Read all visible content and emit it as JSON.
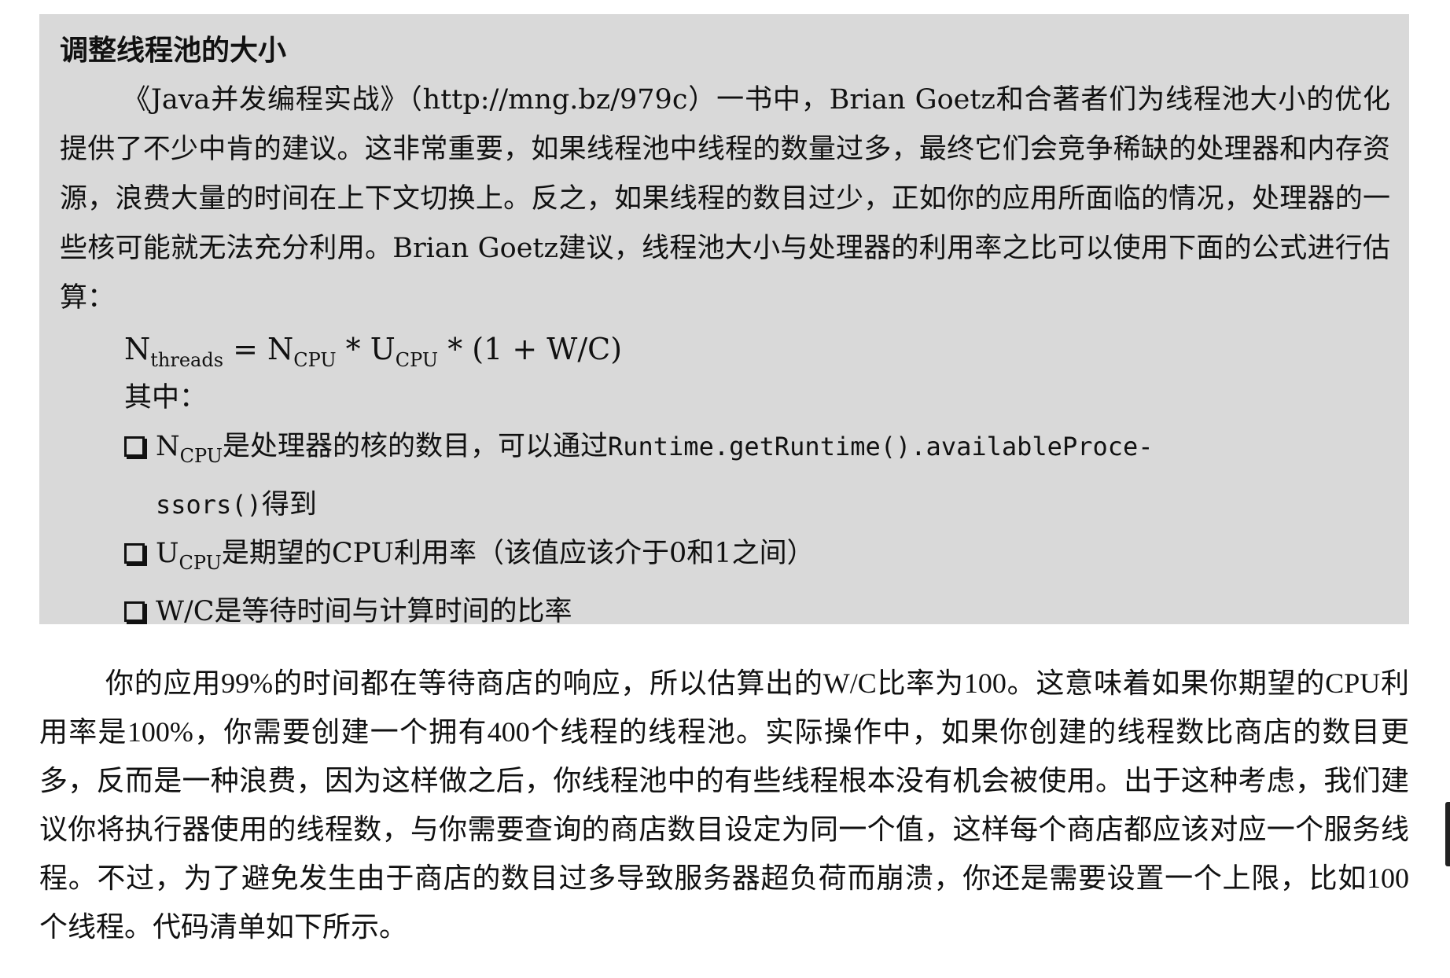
{
  "sidebar": {
    "title": "调整线程池的大小",
    "paragraph": "《Java并发编程实战》（http://mng.bz/979c）一书中，Brian Goetz和合著者们为线程池大小的优化提供了不少中肯的建议。这非常重要，如果线程池中线程的数量过多，最终它们会竞争稀缺的处理器和内存资源，浪费大量的时间在上下文切换上。反之，如果线程的数目过少，正如你的应用所面临的情况，处理器的一些核可能就无法充分利用。Brian Goetz建议，线程池大小与处理器的利用率之比可以使用下面的公式进行估算：",
    "formula": {
      "lhs": "N",
      "lhs_sub": "threads",
      "eq": " = N",
      "cpu_sub": "CPU",
      "times_u": " * U",
      "u_sub": "CPU",
      "rest": " * (1 + W/C)"
    },
    "where_label": "其中：",
    "bullets": [
      {
        "sym": "N",
        "sub": "CPU",
        "text": "是处理器的核的数目，可以通过",
        "code1": "Runtime.getRuntime().availableProce-",
        "code2": "ssors()",
        "tail": "得到"
      },
      {
        "sym": "U",
        "sub": "CPU",
        "text": "是期望的CPU利用率（该值应该介于0和1之间）"
      },
      {
        "text": "W/C是等待时间与计算时间的比率"
      }
    ]
  },
  "main": {
    "paragraph": "你的应用99%的时间都在等待商店的响应，所以估算出的W/C比率为100。这意味着如果你期望的CPU利用率是100%，你需要创建一个拥有400个线程的线程池。实际操作中，如果你创建的线程数比商店的数目更多，反而是一种浪费，因为这样做之后，你线程池中的有些线程根本没有机会被使用。出于这种考虑，我们建议你将执行器使用的线程数，与你需要查询的商店数目设定为同一个值，这样每个商店都应该对应一个服务线程。不过，为了避免发生由于商店的数目过多导致服务器超负荷而崩溃，你还是需要设置一个上限，比如100个线程。代码清单如下所示。"
  }
}
